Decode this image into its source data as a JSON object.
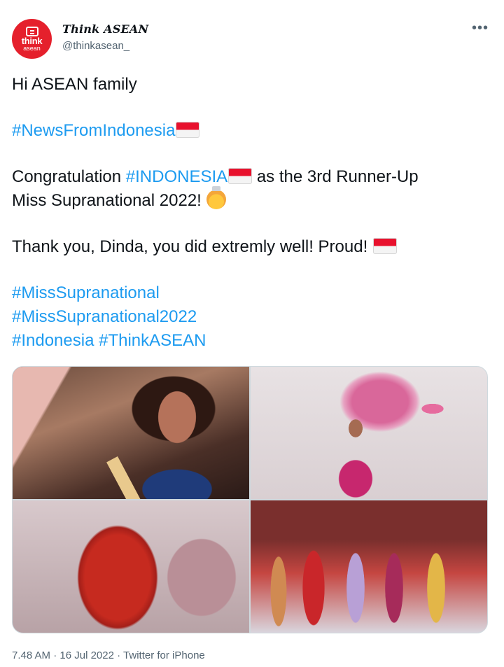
{
  "header": {
    "display_name": "Think ASEAN",
    "handle": "@thinkasean_",
    "more_icon": "more-horizontal-icon",
    "avatar_text_1": "think",
    "avatar_text_2": "asean",
    "avatar_color": "#e5202c"
  },
  "tweet": {
    "greeting": "Hi ASEAN family",
    "hashtag_news": "#NewsFromIndonesia",
    "congrats_prefix": "Congratulation ",
    "hashtag_indonesia_caps": "#INDONESIA",
    "congrats_suffix": " as the 3rd Runner-Up",
    "line_title": "Miss Supranational 2022! ",
    "thanks": "Thank you, Dinda, you did extremly well! Proud! ",
    "hashtag_1": "#MissSupranational",
    "hashtag_2": "#MissSupranational2022",
    "hashtag_3": "#Indonesia",
    "hashtag_4": "#ThinkASEAN",
    "flag_icon": "indonesia-flag-emoji",
    "crown_emoji": "princess-emoji",
    "link_color": "#1d9bf0"
  },
  "media": {
    "count": 4
  },
  "meta": {
    "time": "7.48 AM",
    "date": "16 Jul 2022",
    "source": "Twitter for iPhone",
    "separator": " · "
  }
}
